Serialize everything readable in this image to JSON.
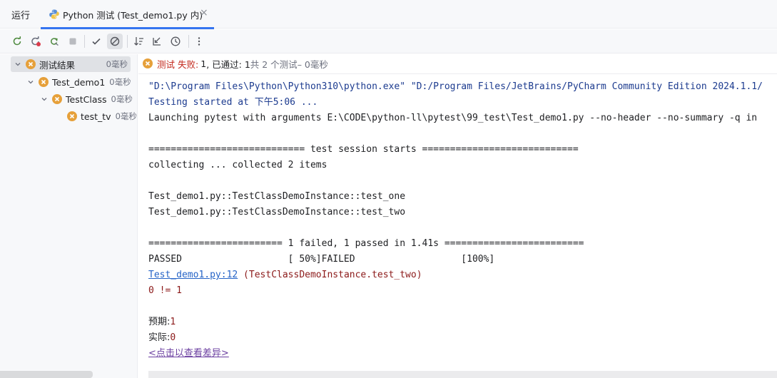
{
  "tabbar": {
    "run_label": "运行",
    "tab_label": "Python 测试 (Test_demo1.py 内)",
    "close_glyph": "×"
  },
  "toolbar": {
    "buttons": [
      "rerun-icon",
      "rerun-failed-icon",
      "toggle-auto-test-icon",
      "stop-icon",
      "show-passed-icon",
      "show-ignored-icon",
      "sort-alphabetically-icon",
      "sort-by-duration-icon",
      "history-icon",
      "more-icon"
    ]
  },
  "tree": {
    "root": {
      "label": "测试结果",
      "duration": "0毫秒"
    },
    "file": {
      "label": "Test_demo1",
      "duration": "0毫秒"
    },
    "class": {
      "label": "TestClass",
      "duration": "0毫秒"
    },
    "test": {
      "label": "test_tv",
      "duration": "0毫秒"
    }
  },
  "status": {
    "prefix": "测试",
    "failed_label": "失败:",
    "failed_count": "1",
    "passed_label": ", 已通过: 1",
    "total": "共 2 个测试",
    "time": " – 0毫秒"
  },
  "console": {
    "line1": "\"D:\\Program Files\\Python\\Python310\\python.exe\" \"D:/Program Files/JetBrains/PyCharm Community Edition 2024.1.1/",
    "line2": "Testing started at 下午5:06 ...",
    "line3": "Launching pytest with arguments E:\\CODE\\python-ll\\pytest\\99_test\\Test_demo1.py --no-header --no-summary -q in",
    "line4": "============================ test session starts ============================",
    "line5": "collecting ... collected 2 items",
    "line6": "Test_demo1.py::TestClassDemoInstance::test_one",
    "line7": "Test_demo1.py::TestClassDemoInstance::test_two",
    "line8": "======================== 1 failed, 1 passed in 1.41s =========================",
    "line9": "PASSED                   [ 50%]FAILED                   [100%]",
    "line10_link": "Test_demo1.py:12",
    "line10_rest": " (TestClassDemoInstance.test_two)",
    "line11": "0 != 1",
    "line12_label": "预期:",
    "line12_value": "1",
    "line13_label": "实际:",
    "line13_value": "0",
    "line14": "<点击以查看差异>"
  },
  "colors": {
    "accent": "#3574f0",
    "fail": "#e6a03a",
    "failed_text": "#c3281c",
    "console_blue": "#1c3b8f",
    "console_red": "#8c1a1a"
  }
}
